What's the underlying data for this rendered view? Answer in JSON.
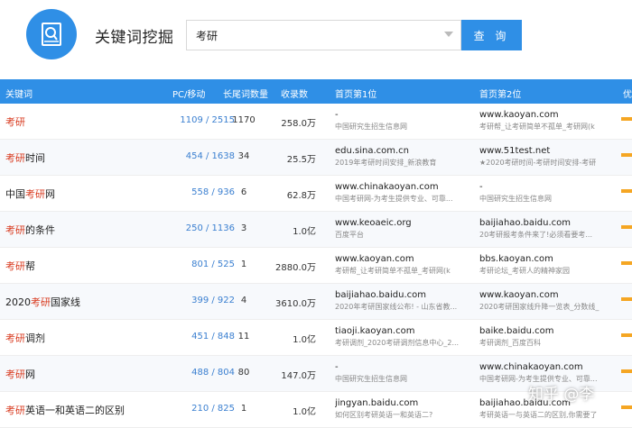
{
  "header": {
    "title": "关键词挖掘",
    "search_value": "考研",
    "search_button": "查 询"
  },
  "columns": [
    "关键词",
    "PC/移动",
    "长尾词数量",
    "收录数",
    "首页第1位",
    "首页第2位",
    "优"
  ],
  "rows": [
    {
      "kw_pre": "",
      "kw_hl": "考研",
      "kw_post": "",
      "pcm": "1109 / 2515",
      "lt": "1170",
      "cnt": "258.0万",
      "r1_url": "-",
      "r1_desc": "中国研究生招生信息网",
      "r2_url": "www.kaoyan.com",
      "r2_desc": "考研帮_让考研简单不孤单_考研网(k"
    },
    {
      "kw_pre": "",
      "kw_hl": "考研",
      "kw_post": "时间",
      "pcm": "454 / 1638",
      "lt": "34",
      "cnt": "25.5万",
      "r1_url": "edu.sina.com.cn",
      "r1_desc": "2019年考研时间安排_新浪教育",
      "r2_url": "www.51test.net",
      "r2_desc": "★2020考研时间-考研时间安排-考研"
    },
    {
      "kw_pre": "中国",
      "kw_hl": "考研",
      "kw_post": "网",
      "pcm": "558 / 936",
      "lt": "6",
      "cnt": "62.8万",
      "r1_url": "www.chinakaoyan.com",
      "r1_desc": "中国考研网-为考生提供专业、可靠...",
      "r2_url": "-",
      "r2_desc": "中国研究生招生信息网"
    },
    {
      "kw_pre": "",
      "kw_hl": "考研",
      "kw_post": "的条件",
      "pcm": "250 / 1136",
      "lt": "3",
      "cnt": "1.0亿",
      "r1_url": "www.keoaeic.org",
      "r1_desc": "百度平台",
      "r2_url": "baijiahao.baidu.com",
      "r2_desc": "20考研报考条件来了!必须看要考..."
    },
    {
      "kw_pre": "",
      "kw_hl": "考研",
      "kw_post": "帮",
      "pcm": "801 / 525",
      "lt": "1",
      "cnt": "2880.0万",
      "r1_url": "www.kaoyan.com",
      "r1_desc": "考研帮_让考研简单不孤单_考研网(k",
      "r2_url": "bbs.kaoyan.com",
      "r2_desc": "考研论坛_考研人的精神家园"
    },
    {
      "kw_pre": "2020",
      "kw_hl": "考研",
      "kw_post": "国家线",
      "pcm": "399 / 922",
      "lt": "4",
      "cnt": "3610.0万",
      "r1_url": "baijiahao.baidu.com",
      "r1_desc": "2020年考研国家线公布! - 山东省教...",
      "r2_url": "www.kaoyan.com",
      "r2_desc": "2020考研国家线升降一览表_分数线_"
    },
    {
      "kw_pre": "",
      "kw_hl": "考研",
      "kw_post": "调剂",
      "pcm": "451 / 848",
      "lt": "11",
      "cnt": "1.0亿",
      "r1_url": "tiaoji.kaoyan.com",
      "r1_desc": "考研调剂_2020考研调剂信息中心_2...",
      "r2_url": "baike.baidu.com",
      "r2_desc": "考研调剂_百度百科"
    },
    {
      "kw_pre": "",
      "kw_hl": "考研",
      "kw_post": "网",
      "pcm": "488 / 804",
      "lt": "80",
      "cnt": "147.0万",
      "r1_url": "-",
      "r1_desc": "中国研究生招生信息网",
      "r2_url": "www.chinakaoyan.com",
      "r2_desc": "中国考研网-为考生提供专业、可靠..."
    },
    {
      "kw_pre": "",
      "kw_hl": "考研",
      "kw_post": "英语一和英语二的区别",
      "pcm": "210 / 825",
      "lt": "1",
      "cnt": "1.0亿",
      "r1_url": "jingyan.baidu.com",
      "r1_desc": "如何区别考研英语一和英语二?",
      "r2_url": "baijiahao.baidu.com",
      "r2_desc": "考研英语一与英语二的区别,你需要了"
    }
  ],
  "watermark": "知乎 @李",
  "colors": {
    "accent": "#2f8fe6",
    "highlight": "#d83a1f",
    "bar": "#f5a623"
  }
}
